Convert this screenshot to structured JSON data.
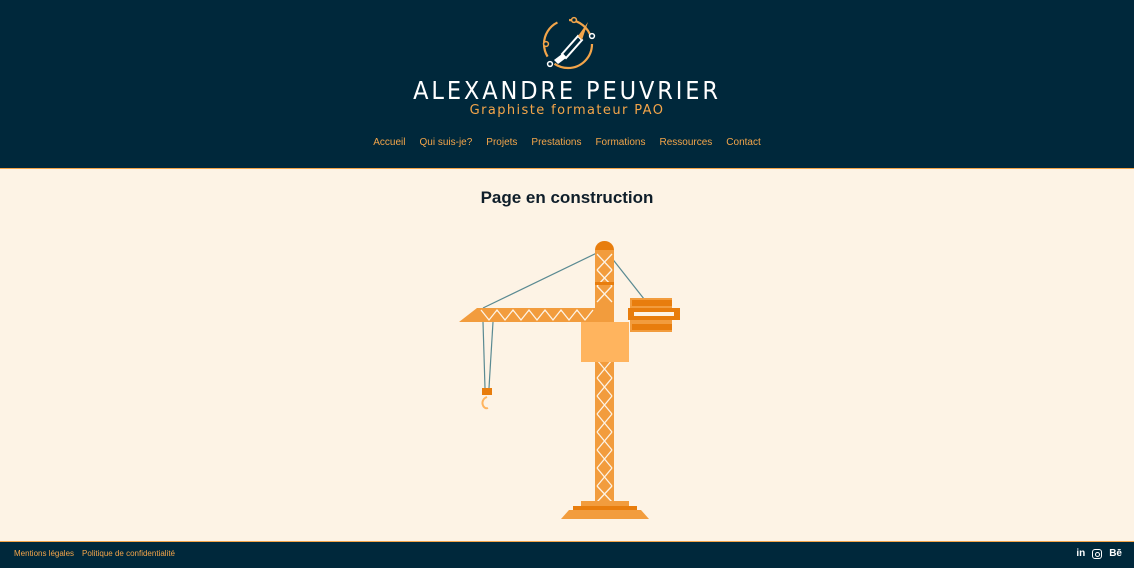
{
  "header": {
    "brand_name": "ALEXANDRE PEUVRIER",
    "brand_subtitle": "Graphiste formateur PAO",
    "logo_icon": "pen-nib-circle-icon"
  },
  "nav": {
    "items": [
      "Accueil",
      "Qui suis-je?",
      "Projets",
      "Prestations",
      "Formations",
      "Ressources",
      "Contact"
    ]
  },
  "main": {
    "title": "Page en construction",
    "illustration": "construction-crane-illustration"
  },
  "footer": {
    "links": [
      "Mentions légales",
      "Politique de confidentialité"
    ],
    "social": {
      "linkedin": "in",
      "instagram_icon": "instagram-icon",
      "behance": "Bē"
    }
  },
  "colors": {
    "navy": "#00283b",
    "accent": "#f3a54a",
    "background": "#fdf3e5",
    "crane_orange": "#f29c3d",
    "crane_dark": "#e87d0d"
  }
}
